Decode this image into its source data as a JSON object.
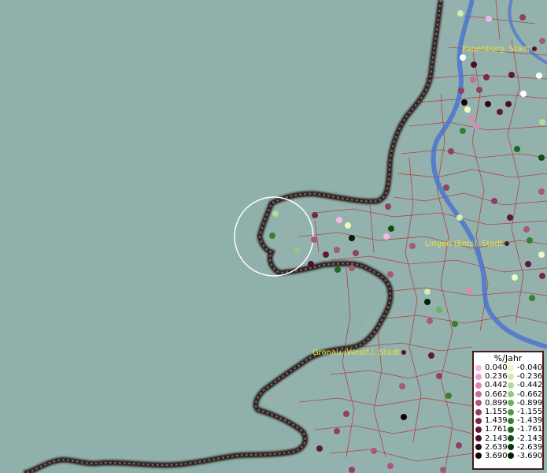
{
  "map": {
    "water_color": "#8fb0ab",
    "border_color": "#2a1a1a",
    "district_line_color": "#b83030",
    "river_color": "#4a6fd0",
    "highlight_circle_color": "#ffffff"
  },
  "cities": [
    {
      "id": "papenburg",
      "name": "Papenburg, Stadt"
    },
    {
      "id": "lingen",
      "name": "Lingen (Ems), Stadt"
    },
    {
      "id": "gronau",
      "name": "Gronau (Westf.), Stadt"
    }
  ],
  "legend": {
    "title": "%/Jahr",
    "increase": [
      {
        "value": "0.040",
        "color": "#f4b8e8"
      },
      {
        "value": "0.236",
        "color": "#e8a0d0"
      },
      {
        "value": "0.442",
        "color": "#d888b8"
      },
      {
        "value": "0.662",
        "color": "#c07090"
      },
      {
        "value": "0.899",
        "color": "#a85878"
      },
      {
        "value": "1.155",
        "color": "#904060"
      },
      {
        "value": "1.439",
        "color": "#782848"
      },
      {
        "value": "1.761",
        "color": "#601838"
      },
      {
        "value": "2.143",
        "color": "#481028"
      },
      {
        "value": "2.639",
        "color": "#300818"
      },
      {
        "value": "3.690",
        "color": "#180008"
      }
    ],
    "decrease": [
      {
        "value": "-0.040",
        "color": "#f0f8c0"
      },
      {
        "value": "-0.236",
        "color": "#d0ecb0"
      },
      {
        "value": "-0.442",
        "color": "#b0dc98"
      },
      {
        "value": "-0.662",
        "color": "#90c880"
      },
      {
        "value": "-0.899",
        "color": "#70b060"
      },
      {
        "value": "-1.155",
        "color": "#509848"
      },
      {
        "value": "-1.439",
        "color": "#388030"
      },
      {
        "value": "-1.761",
        "color": "#206820"
      },
      {
        "value": "-2.143",
        "color": "#105010"
      },
      {
        "value": "-2.639",
        "color": "#083808"
      },
      {
        "value": "-3.690",
        "color": "#002000"
      }
    ]
  }
}
